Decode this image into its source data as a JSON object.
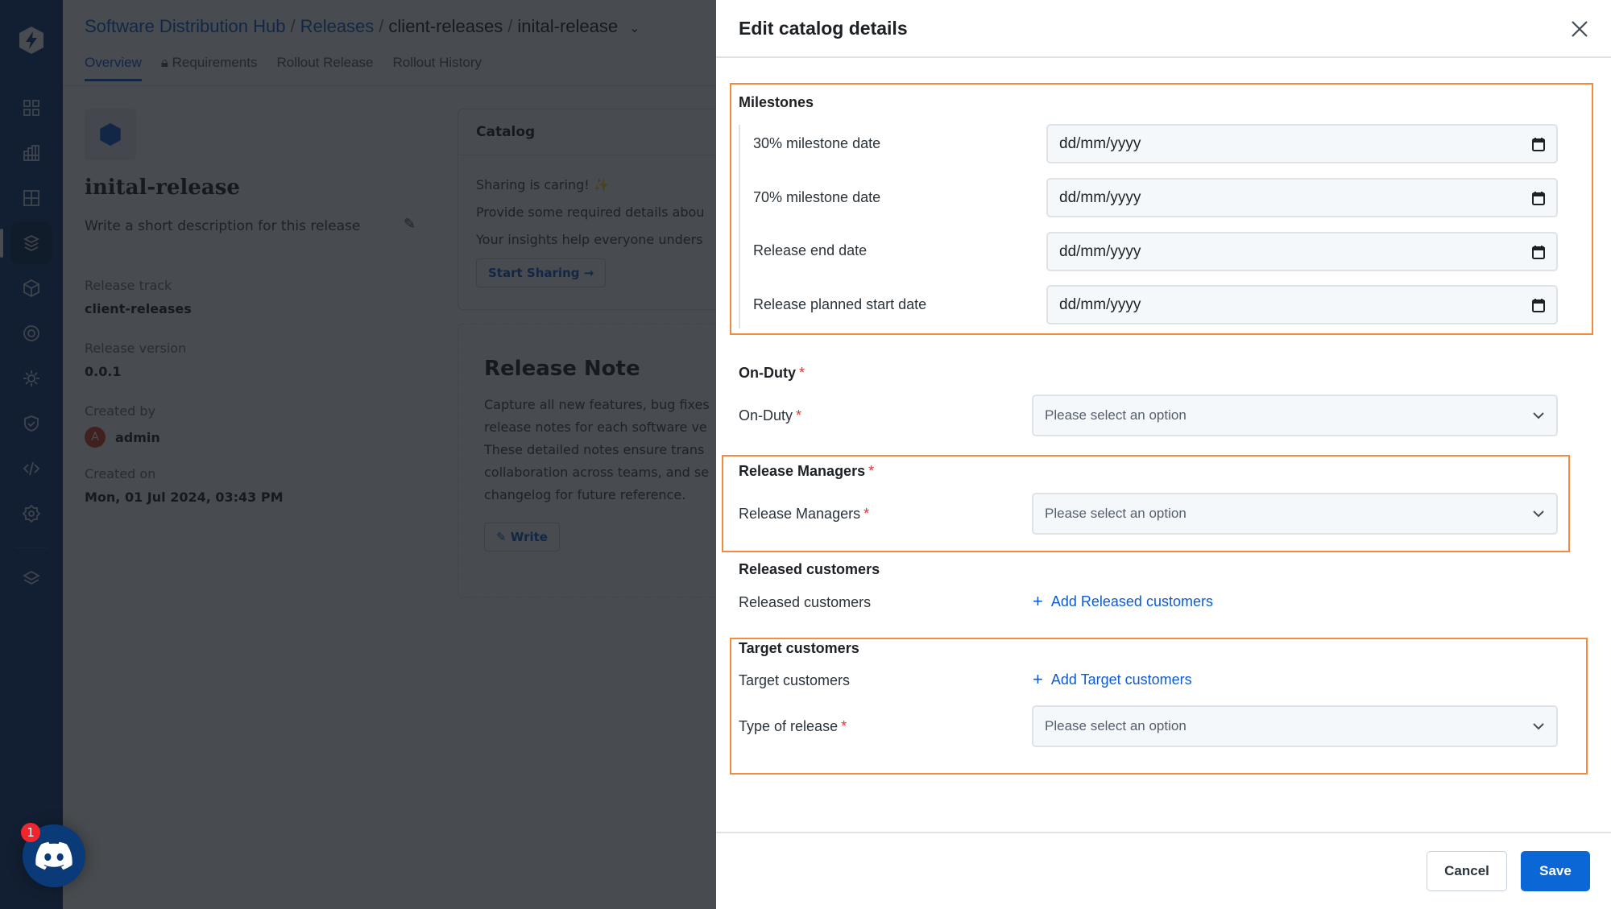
{
  "app": {
    "breadcrumb": [
      {
        "label": "Software Distribution Hub",
        "link": true
      },
      {
        "label": "Releases",
        "link": true
      },
      {
        "label": "client-releases",
        "link": false
      },
      {
        "label": "inital-release",
        "link": false
      }
    ],
    "tabs": [
      {
        "label": "Overview",
        "active": true
      },
      {
        "label": "Requirements",
        "active": false,
        "icon": "lock-icon"
      },
      {
        "label": "Rollout Release",
        "active": false
      },
      {
        "label": "Rollout History",
        "active": false
      }
    ],
    "release": {
      "title": "inital-release",
      "description_placeholder": "Write a short description for this release",
      "meta": [
        {
          "key": "Release track",
          "value": "client-releases"
        },
        {
          "key": "Release version",
          "value": "0.0.1"
        },
        {
          "key": "Created by",
          "value": "admin",
          "avatar": "A"
        },
        {
          "key": "Created on",
          "value": "Mon, 01 Jul 2024, 03:43 PM"
        }
      ]
    },
    "catalog_card": {
      "title": "Catalog",
      "lines": [
        "Sharing is caring! ✨",
        "Provide some required details abou",
        "Your insights help everyone unders"
      ],
      "button": "Start Sharing →"
    },
    "note_card": {
      "title": "Release Note",
      "lines": [
        "Capture all new features, bug fixes",
        "release notes for each software ve",
        "These detailed notes ensure trans",
        "collaboration across teams, and se",
        "changelog for future reference."
      ],
      "button": "Write"
    },
    "sidebar_icons": [
      "logo-icon",
      "dashboard-icon",
      "apps-grid-icon",
      "grid-icon",
      "release-icon",
      "package-icon",
      "target-icon",
      "gear-sun-icon",
      "shield-check-icon",
      "code-icon",
      "settings-icon",
      "layers-icon"
    ],
    "discord": {
      "badge": "1"
    }
  },
  "drawer": {
    "title": "Edit catalog details",
    "milestones": {
      "title": "Milestones",
      "fields": [
        {
          "label": "30% milestone date",
          "value": "dd/mm/yyyy"
        },
        {
          "label": "70% milestone date",
          "value": "dd/mm/yyyy"
        },
        {
          "label": "Release end date",
          "value": "dd/mm/yyyy"
        },
        {
          "label": "Release planned start date",
          "value": "dd/mm/yyyy"
        }
      ]
    },
    "on_duty": {
      "title": "On-Duty",
      "label": "On-Duty",
      "placeholder": "Please select an option",
      "required": "*"
    },
    "release_managers": {
      "title": "Release Managers",
      "label": "Release Managers",
      "placeholder": "Please select an option",
      "required": "*"
    },
    "released_customers": {
      "title": "Released customers",
      "label": "Released customers",
      "add": "Add Released customers"
    },
    "target_customers": {
      "title": "Target customers",
      "label": "Target customers",
      "add": "Add Target customers"
    },
    "type_of_release": {
      "label": "Type of release",
      "placeholder": "Please select an option",
      "required": "*"
    },
    "cancel": "Cancel",
    "save": "Save"
  },
  "colors": {
    "accent": "#0b66d6",
    "highlight": "#f48a3c",
    "required": "#e5332a",
    "sidebar": "#0b3a7a"
  }
}
